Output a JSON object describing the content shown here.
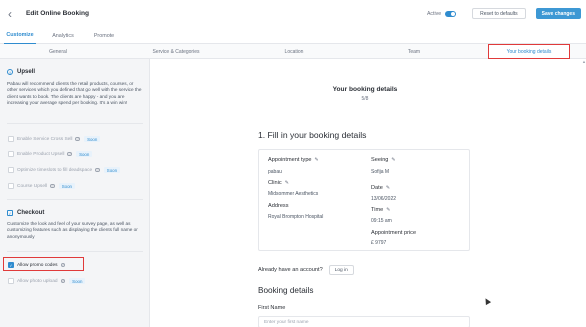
{
  "header": {
    "back_icon": "chevron-left-icon",
    "title": "Edit Online Booking",
    "active_label": "Active",
    "active_on": true,
    "reset_label": "Reset to defaults",
    "save_label": "Save changes"
  },
  "main_tabs": [
    {
      "label": "Customize",
      "active": true
    },
    {
      "label": "Analytics",
      "active": false
    },
    {
      "label": "Promote",
      "active": false
    }
  ],
  "sub_tabs": [
    {
      "label": "General",
      "active": false
    },
    {
      "label": "Service & Categories",
      "active": false
    },
    {
      "label": "Location",
      "active": false
    },
    {
      "label": "Team",
      "active": false
    },
    {
      "label": "Your booking details",
      "active": true
    }
  ],
  "sidebar": {
    "upsell": {
      "title": "Upsell",
      "description": "Pabau will recommend clients the retail products, courses, or other services which you defined that go well with the service the client wants to book. The clients are happy - and you are increasing your average spend per booking. It's a win win!",
      "options": [
        {
          "label": "Enable Service Cross Sell",
          "soon": "Soon",
          "checked": false
        },
        {
          "label": "Enable Product Upsell",
          "soon": "Soon",
          "checked": false
        },
        {
          "label": "Optimize timeslots to fill deadspace",
          "soon": "Soon",
          "checked": false
        },
        {
          "label": "Course Upsell",
          "soon": "Soon",
          "checked": false
        }
      ]
    },
    "checkout": {
      "title": "Checkout",
      "description": "Customize the look and feel of your survey page, as well as customizing features such as displaying the clients full name or anonymously",
      "options": [
        {
          "label": "Allow promo codes",
          "checked": true
        },
        {
          "label": "Allow photo upload",
          "soon": "Soon",
          "checked": false
        }
      ]
    }
  },
  "content": {
    "title": "Your booking details",
    "step": "5/8",
    "section1": "1. Fill in your booking details",
    "fields": {
      "appointment_type_label": "Appointment type",
      "appointment_type_value": "pabau",
      "seeing_label": "Seeing",
      "seeing_value": "Sofija M",
      "clinic_label": "Clinic",
      "clinic_value": "Midsommer Aesthetics",
      "date_label": "Date",
      "date_value": "13/06/2022",
      "address_label": "Address",
      "address_value": "Royal Brompton Hospital",
      "time_label": "Time",
      "time_value": "09:15 am",
      "price_label": "Appointment price",
      "price_value": "£ 9797"
    },
    "have_account": "Already have an account?",
    "login_label": "Log in",
    "section2": "Booking details",
    "first_name_label": "First Name",
    "first_name_placeholder": "Enter your first name"
  },
  "colors": {
    "accent": "#2f8ccf",
    "highlight": "#e03a3a"
  }
}
